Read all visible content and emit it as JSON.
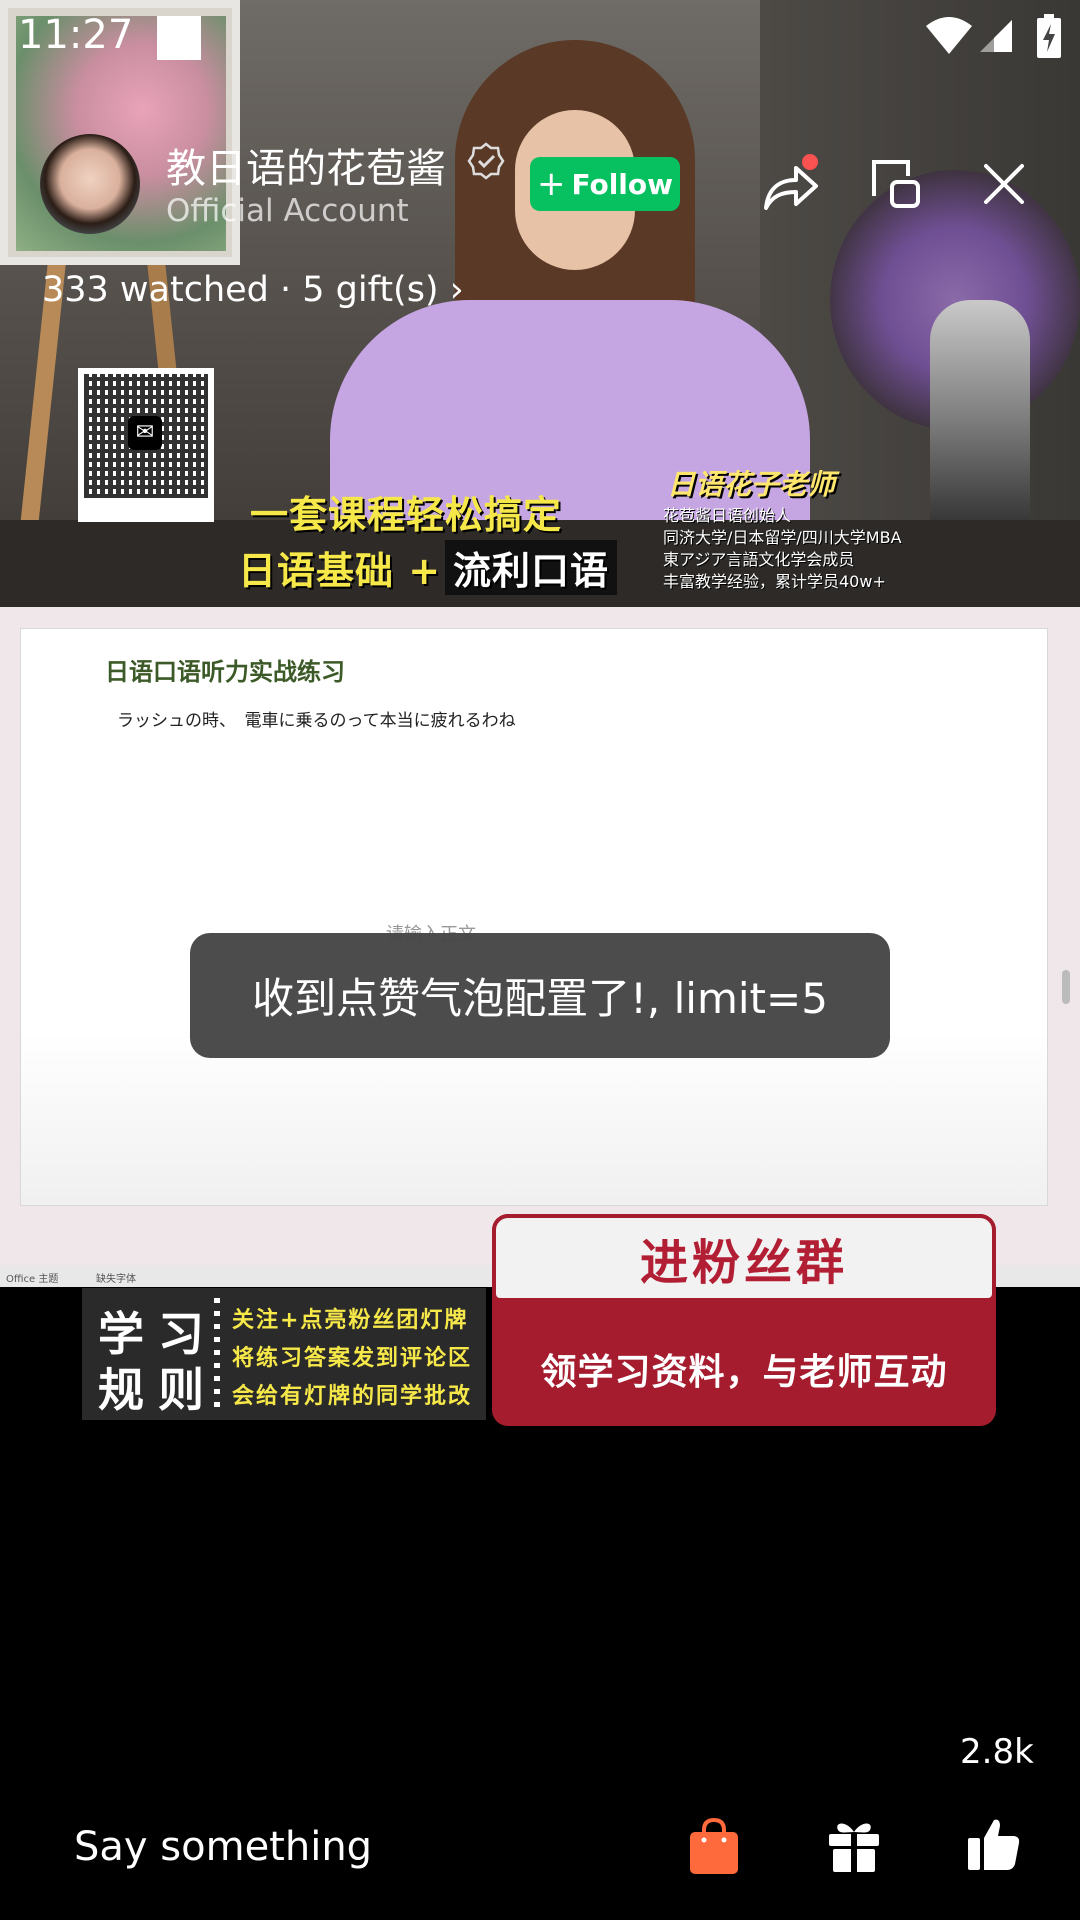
{
  "status_bar": {
    "time": "11:27"
  },
  "header": {
    "host_name": "教日语的花苞酱",
    "account_type": "Official Account",
    "follow_label": "Follow",
    "follow_plus": "+",
    "stats": "333 watched · 5 gift(s) ›"
  },
  "video": {
    "promo_line1": "一套课程轻松搞定",
    "promo_line2": "日语基础 +",
    "promo_line2_highlight": "流利口语",
    "teacher_name": "日语花子老师",
    "teacher_lines": [
      "花苞酱日语创始人",
      "同济大学/日本留学/四川大学MBA",
      "東アジア言語文化学会成员",
      "丰富教学经验，累计学员40w+"
    ]
  },
  "slide": {
    "title": "日语口语听力实战练习",
    "text": "ラッシュの時、　電車に乗るのって本当に疲れるわね",
    "placeholder": "请输入正文",
    "footer_left": "Office 主题",
    "footer_mid": "缺失字体"
  },
  "toast": {
    "message": "收到点赞气泡配置了!, limit=5"
  },
  "banners": {
    "rules_title_line1": "学习",
    "rules_title_line2": "规则",
    "rules_lines": [
      "关注+点亮粉丝团灯牌",
      "将练习答案发到评论区",
      "会给有灯牌的同学批改"
    ],
    "fans_title": "进粉丝群",
    "fans_subtitle": "领学习资料，与老师互动"
  },
  "bottom_bar": {
    "like_count": "2.8k",
    "comment_placeholder": "Say something",
    "icons": [
      "shopping-bag-icon",
      "gift-icon",
      "thumbs-up-icon"
    ]
  },
  "colors": {
    "follow_green": "#07c160",
    "badge_red": "#fa5151",
    "shop_orange": "#ff6a3c",
    "fans_red": "#a51c2f"
  }
}
